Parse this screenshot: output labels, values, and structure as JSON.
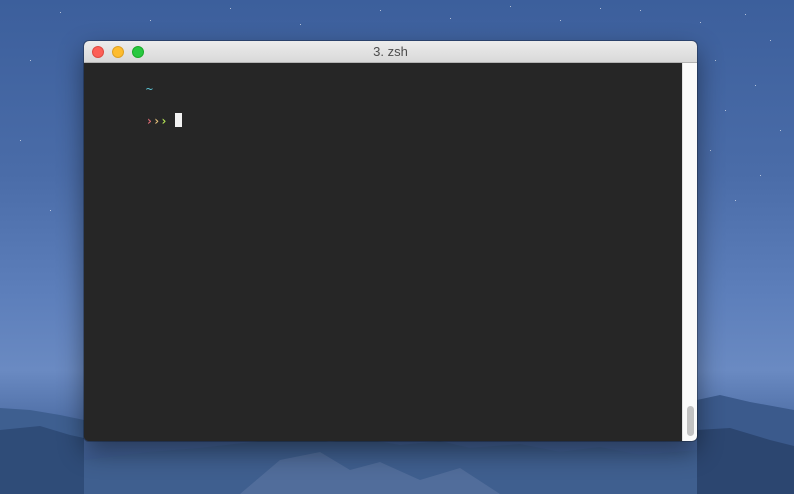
{
  "window": {
    "title": "3. zsh"
  },
  "terminal": {
    "prompt_dir": "~",
    "prompt_arrows": [
      "›",
      "›",
      "›"
    ],
    "prompt_arrow_colors": [
      "#e06c75",
      "#e5c07b",
      "#b5e655"
    ],
    "input_text": ""
  },
  "colors": {
    "terminal_background": "#262626",
    "prompt_dir_color": "#5bc6d6",
    "cursor_color": "#f2f2f2"
  },
  "icons": {
    "close": "close-traffic-light-icon",
    "minimize": "minimize-traffic-light-icon",
    "zoom": "zoom-traffic-light-icon"
  }
}
